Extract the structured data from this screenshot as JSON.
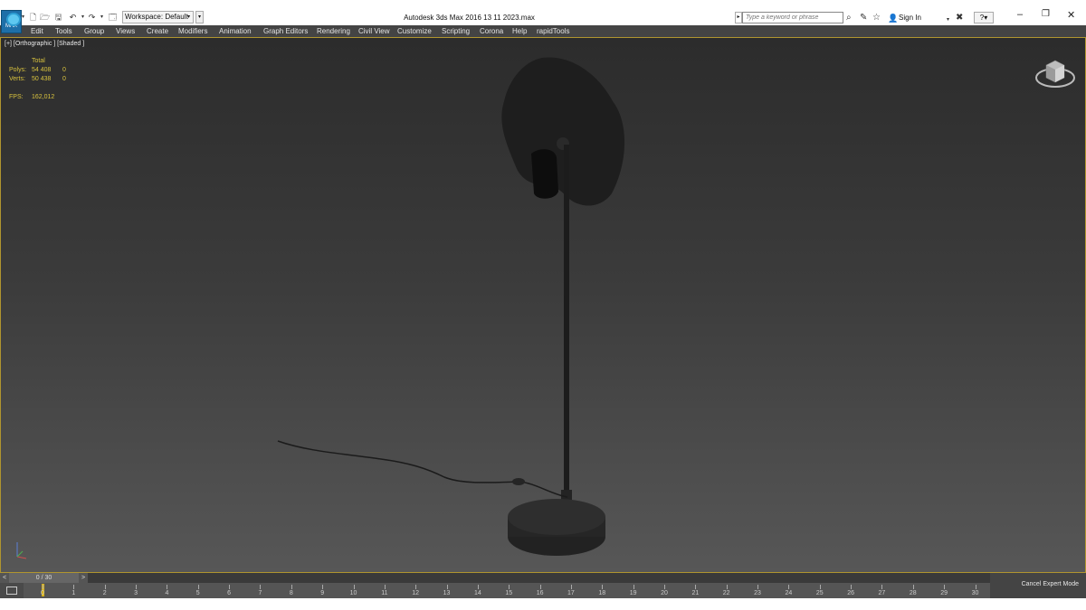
{
  "app": {
    "logo_label": "MAX",
    "title": "Autodesk 3ds Max 2016      13 11 2023.max"
  },
  "quick_access": {
    "workspace": "Workspace: Default"
  },
  "search": {
    "placeholder": "Type a keyword or phrase"
  },
  "account": {
    "sign_in": "Sign In"
  },
  "menu": [
    "Edit",
    "Tools",
    "Group",
    "Views",
    "Create",
    "Modifiers",
    "Animation",
    "Graph Editors",
    "Rendering",
    "Civil View",
    "Customize",
    "Scripting",
    "Corona",
    "Help",
    "rapidTools"
  ],
  "viewport": {
    "label": "[+] [Orthographic ] [Shaded ]",
    "stats": {
      "header": "Total",
      "polys_label": "Polys:",
      "polys_value": "54 408",
      "polys_sel": "0",
      "verts_label": "Verts:",
      "verts_value": "50 438",
      "verts_sel": "0",
      "fps_label": "FPS:",
      "fps_value": "162,012"
    }
  },
  "timeline": {
    "frame": "0 / 30",
    "prev": "<",
    "next": ">",
    "ticks": [
      "0",
      "1",
      "2",
      "3",
      "4",
      "5",
      "6",
      "7",
      "8",
      "9",
      "10",
      "11",
      "12",
      "13",
      "14",
      "15",
      "16",
      "17",
      "18",
      "19",
      "20",
      "21",
      "22",
      "23",
      "24",
      "25",
      "26",
      "27",
      "28",
      "29",
      "30"
    ]
  },
  "status": {
    "cancel_expert": "Cancel Expert Mode"
  },
  "colors": {
    "menubar": "#444444",
    "viewport_border": "#b0952f",
    "stats_text": "#d8c23e"
  }
}
